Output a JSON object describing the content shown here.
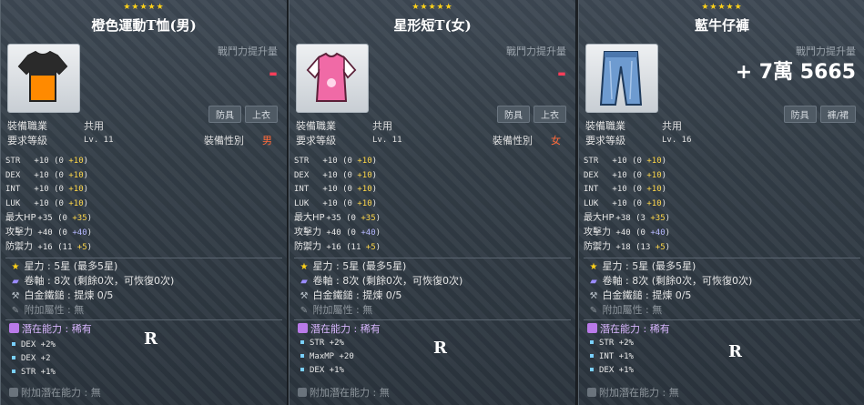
{
  "labels": {
    "power": "戰鬥力提升量",
    "job": "裝備職業",
    "level": "要求等級",
    "gender": "裝備性別",
    "starforce": "星力",
    "scroll": "卷軸",
    "hammer": "白金鐵鎚",
    "attr": "附加屬性",
    "potential": "潛在能力",
    "add_potential": "附加潛在能力"
  },
  "colors": {
    "minus": "#ff3e5a",
    "bonus": "#ffd84a",
    "scroll_bonus": "#b6b8ff",
    "potential": "#d9b7ff"
  },
  "items": [
    {
      "stars": "★★★★★",
      "name": "橙色運動T恤(男)",
      "power": "-",
      "icon": "orange-tshirt-icon",
      "tags": [
        "防具",
        "上衣"
      ],
      "job": "共用",
      "level": "Lv. 11",
      "gender": "男",
      "stats": [
        {
          "k": "STR",
          "base": "+10",
          "open": "(0",
          "bonus": "+10",
          "close": ")"
        },
        {
          "k": "DEX",
          "base": "+10",
          "open": "(0",
          "bonus": "+10",
          "close": ")"
        },
        {
          "k": "INT",
          "base": "+10",
          "open": "(0",
          "bonus": "+10",
          "close": ")"
        },
        {
          "k": "LUK",
          "base": "+10",
          "open": "(0",
          "bonus": "+10",
          "close": ")"
        },
        {
          "k": "最大HP",
          "base": "+35",
          "open": "(0",
          "bonus": "+35",
          "close": ")"
        },
        {
          "k": "攻擊力",
          "base": "+40",
          "open": "(0",
          "bonus": "+40",
          "close": ")"
        },
        {
          "k": "防禦力",
          "base": "+16",
          "open": "(11",
          "bonus": "+5",
          "close": ")"
        }
      ],
      "starforce": "5星 (最多5星)",
      "scroll": "8次 (剩餘0次，可恢復0次)",
      "hammer": "提煉 0/5",
      "attr": "無",
      "potential_rank_name": "稀有",
      "potential_rank_letter": "R",
      "potential_lines": [
        "DEX +2%",
        "DEX +2",
        "STR +1%"
      ],
      "add_potential": "無"
    },
    {
      "stars": "★★★★★",
      "name": "星形短T(女)",
      "power": "-",
      "icon": "pink-shirt-icon",
      "tags": [
        "防具",
        "上衣"
      ],
      "job": "共用",
      "level": "Lv. 11",
      "gender": "女",
      "stats": [
        {
          "k": "STR",
          "base": "+10",
          "open": "(0",
          "bonus": "+10",
          "close": ")"
        },
        {
          "k": "DEX",
          "base": "+10",
          "open": "(0",
          "bonus": "+10",
          "close": ")"
        },
        {
          "k": "INT",
          "base": "+10",
          "open": "(0",
          "bonus": "+10",
          "close": ")"
        },
        {
          "k": "LUK",
          "base": "+10",
          "open": "(0",
          "bonus": "+10",
          "close": ")"
        },
        {
          "k": "最大HP",
          "base": "+35",
          "open": "(0",
          "bonus": "+35",
          "close": ")"
        },
        {
          "k": "攻擊力",
          "base": "+40",
          "open": "(0",
          "bonus": "+40",
          "close": ")"
        },
        {
          "k": "防禦力",
          "base": "+16",
          "open": "(11",
          "bonus": "+5",
          "close": ")"
        }
      ],
      "starforce": "5星 (最多5星)",
      "scroll": "8次 (剩餘0次，可恢復0次)",
      "hammer": "提煉 0/5",
      "attr": "無",
      "potential_rank_name": "稀有",
      "potential_rank_letter": "R",
      "potential_lines": [
        "STR +2%",
        "MaxMP +20",
        "DEX +1%"
      ],
      "add_potential": "無"
    },
    {
      "stars": "★★★★★",
      "name": "藍牛仔褲",
      "power": "+ 7萬 5665",
      "icon": "blue-jeans-icon",
      "tags": [
        "防具",
        "褲/裙"
      ],
      "job": "共用",
      "level": "Lv. 16",
      "gender": "",
      "stats": [
        {
          "k": "STR",
          "base": "+10",
          "open": "(0",
          "bonus": "+10",
          "close": ")"
        },
        {
          "k": "DEX",
          "base": "+10",
          "open": "(0",
          "bonus": "+10",
          "close": ")"
        },
        {
          "k": "INT",
          "base": "+10",
          "open": "(0",
          "bonus": "+10",
          "close": ")"
        },
        {
          "k": "LUK",
          "base": "+10",
          "open": "(0",
          "bonus": "+10",
          "close": ")"
        },
        {
          "k": "最大HP",
          "base": "+38",
          "open": "(3",
          "bonus": "+35",
          "close": ")"
        },
        {
          "k": "攻擊力",
          "base": "+40",
          "open": "(0",
          "bonus": "+40",
          "close": ")"
        },
        {
          "k": "防禦力",
          "base": "+18",
          "open": "(13",
          "bonus": "+5",
          "close": ")"
        }
      ],
      "starforce": "5星 (最多5星)",
      "scroll": "8次 (剩餘0次，可恢復0次)",
      "hammer": "提煉 0/5",
      "attr": "無",
      "potential_rank_name": "稀有",
      "potential_rank_letter": "R",
      "potential_lines": [
        "STR +2%",
        "INT +1%",
        "DEX +1%"
      ],
      "add_potential": "無"
    }
  ]
}
